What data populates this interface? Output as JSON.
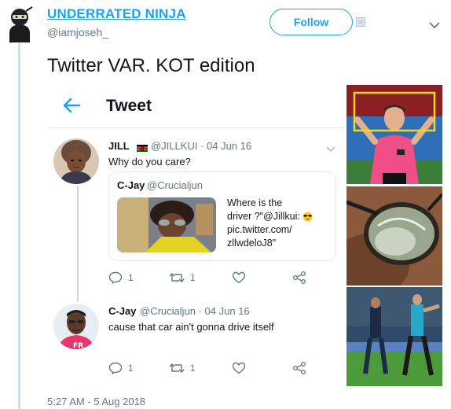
{
  "header": {
    "display_name": "UNDERRATED NINJA",
    "handle": "@iamjoseh_",
    "follow_label": "Follow"
  },
  "tweet": {
    "text": "Twitter VAR. KOT edition",
    "timestamp": "5:27 AM - 5 Aug 2018"
  },
  "screenshot": {
    "heading": "Tweet",
    "reply_1": {
      "name": "JILL",
      "meta": "@JILLKUI · 04 Jun 16",
      "text": "Why do you care?",
      "quote": {
        "name": "C-Jay",
        "handle": "@Crucialjun",
        "text_lines": [
          "Where is the",
          "driver ?\"@Jillkui:",
          "pic.twitter.com/",
          "zllwdeloJ8\""
        ]
      },
      "reply_count": "1",
      "retweet_count": "1"
    },
    "reply_2": {
      "name": "C-Jay",
      "meta": "@Crucialjun · 04 Jun 16",
      "text": "cause that car ain't gonna drive itself",
      "reply_count": "1",
      "retweet_count": "1"
    }
  },
  "colors": {
    "accent": "#1da1f2",
    "thread_line": "#c4e3f8",
    "muted_text": "#657786"
  },
  "icons": [
    "ninja-avatar-icon",
    "follow-dm-icon",
    "chevron-down-icon",
    "back-arrow-icon",
    "kenya-flag-icon",
    "reply-icon",
    "retweet-icon",
    "heart-icon",
    "share-icon",
    "sunglasses-emoji-icon"
  ]
}
